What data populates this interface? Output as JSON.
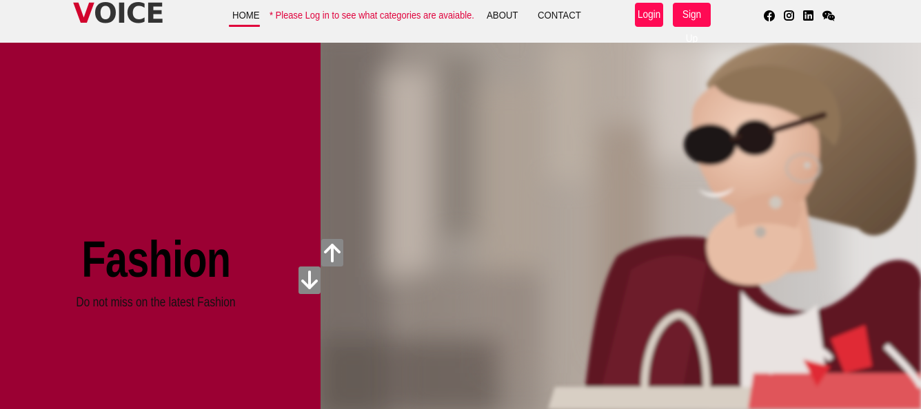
{
  "brand": {
    "logo_first_letter": "V",
    "logo_rest": "OICE",
    "accent_color": "#d2042d"
  },
  "nav": {
    "home": "HOME",
    "notice": "* Please Log in to see what categories are avaiable.",
    "about": "ABOUT",
    "contact": "CONTACT"
  },
  "auth": {
    "login": "Login",
    "signup": "Sign Up",
    "button_color": "#ff0a54"
  },
  "social": [
    "facebook-icon",
    "instagram-icon",
    "linkedin-icon",
    "wechat-icon"
  ],
  "hero": {
    "title": "Fashion",
    "subtitle": "Do not miss on the latest Fashion",
    "panel_color": "#9b0033",
    "image": "woman-with-sunglasses-and-shopping-bags"
  },
  "carousel": {
    "up_icon": "arrow-up-icon",
    "down_icon": "arrow-down-icon"
  }
}
